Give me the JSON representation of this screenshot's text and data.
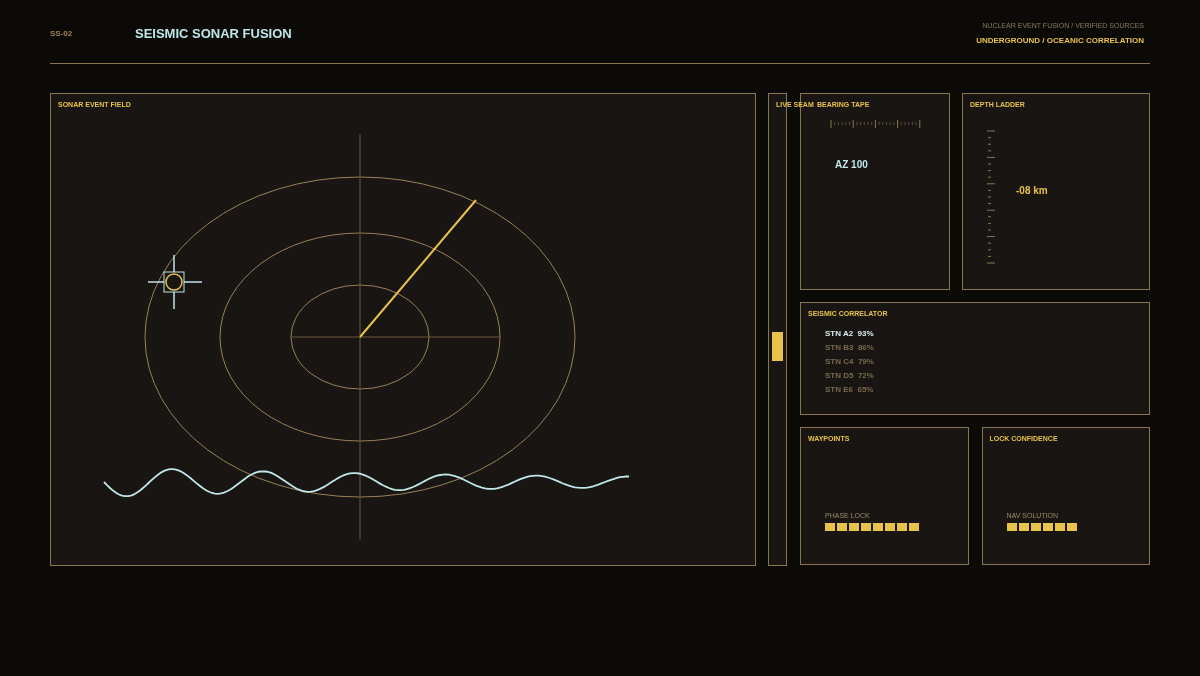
{
  "header": {
    "code": "SS-02",
    "title": "SEISMIC SONAR FUSION",
    "subtitle": "NUCLEAR EVENT FUSION / VERIFIED SOURCES",
    "mode": "UNDERGROUND / OCEANIC CORRELATION"
  },
  "sonar_field": {
    "title": "SONAR EVENT FIELD"
  },
  "live_seam": {
    "title": "LIVE SEAM"
  },
  "bearing_tape": {
    "title": "BEARING TAPE",
    "reading": "AZ 100"
  },
  "depth_ladder": {
    "title": "DEPTH LADDER",
    "reading": "-08 km"
  },
  "seismic_correlator": {
    "title": "SEISMIC CORRELATOR",
    "stations": [
      {
        "name": "STN A2",
        "value": "93%",
        "selected": true
      },
      {
        "name": "STN B3",
        "value": "86%",
        "selected": false
      },
      {
        "name": "STN C4",
        "value": "79%",
        "selected": false
      },
      {
        "name": "STN D5",
        "value": "72%",
        "selected": false
      },
      {
        "name": "STN E6",
        "value": "65%",
        "selected": false
      }
    ]
  },
  "waypoints": {
    "title": "WAYPOINTS",
    "meter": {
      "label": "PHASE LOCK",
      "stars": 8
    }
  },
  "lock_confidence": {
    "title": "LOCK CONFIDENCE",
    "meter": {
      "label": "NAV SOLUTION",
      "stars": 6
    }
  }
}
